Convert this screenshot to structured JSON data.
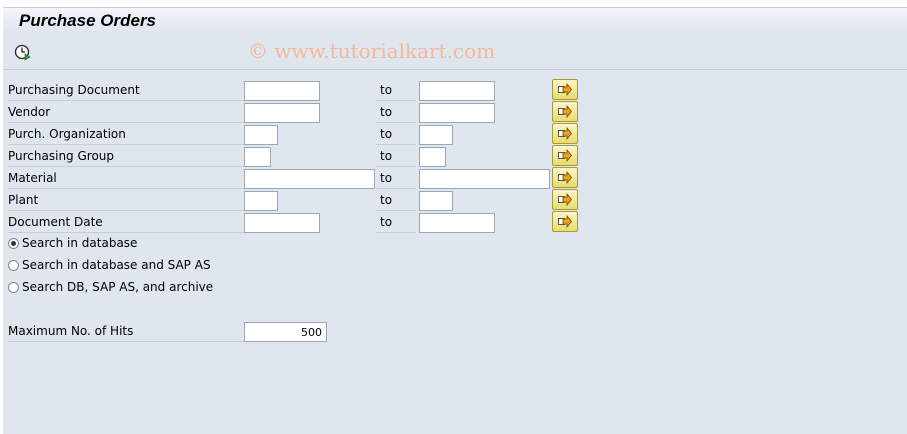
{
  "window": {
    "title": "Purchase Orders"
  },
  "toolbar": {
    "execute_icon": "execute-clock-icon"
  },
  "watermark": "© www.tutorialkart.com",
  "fields": [
    {
      "id": "purchasing-document",
      "label": "Purchasing Document",
      "to_label": "to",
      "from_value": "",
      "to_value": ""
    },
    {
      "id": "vendor",
      "label": "Vendor",
      "to_label": "to",
      "from_value": "",
      "to_value": ""
    },
    {
      "id": "purch-organization",
      "label": "Purch. Organization",
      "to_label": "to",
      "from_value": "",
      "to_value": ""
    },
    {
      "id": "purchasing-group",
      "label": "Purchasing Group",
      "to_label": "to",
      "from_value": "",
      "to_value": ""
    },
    {
      "id": "material",
      "label": "Material",
      "to_label": "to",
      "from_value": "",
      "to_value": ""
    },
    {
      "id": "plant",
      "label": "Plant",
      "to_label": "to",
      "from_value": "",
      "to_value": ""
    },
    {
      "id": "document-date",
      "label": "Document Date",
      "to_label": "to",
      "from_value": "",
      "to_value": ""
    }
  ],
  "search_options": [
    {
      "label": "Search in database",
      "selected": true
    },
    {
      "label": "Search in database and SAP AS",
      "selected": false
    },
    {
      "label": "Search DB, SAP AS, and archive",
      "selected": false
    }
  ],
  "max_hits": {
    "label": "Maximum No. of Hits",
    "value": "500"
  },
  "colors": {
    "background": "#dfe6ee",
    "button": "#e9dc6d",
    "watermark": "#f2b99c"
  }
}
